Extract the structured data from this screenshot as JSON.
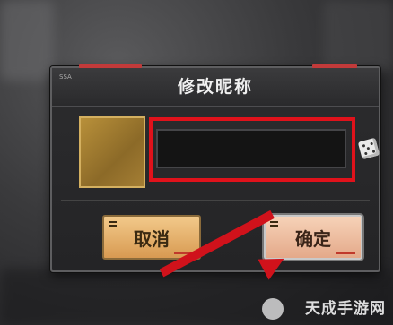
{
  "dialog": {
    "corner_tag": "SSA",
    "title": "修改昵称",
    "name_input": {
      "value": "",
      "placeholder": ""
    },
    "buttons": {
      "cancel": "取消",
      "confirm": "确定"
    }
  },
  "icons": {
    "randomize": "dice-icon"
  },
  "watermark": {
    "text": "天成手游网"
  },
  "colors": {
    "highlight": "#e0121b",
    "cancel_bg": "#e0a860",
    "confirm_bg": "#ecbca0"
  }
}
